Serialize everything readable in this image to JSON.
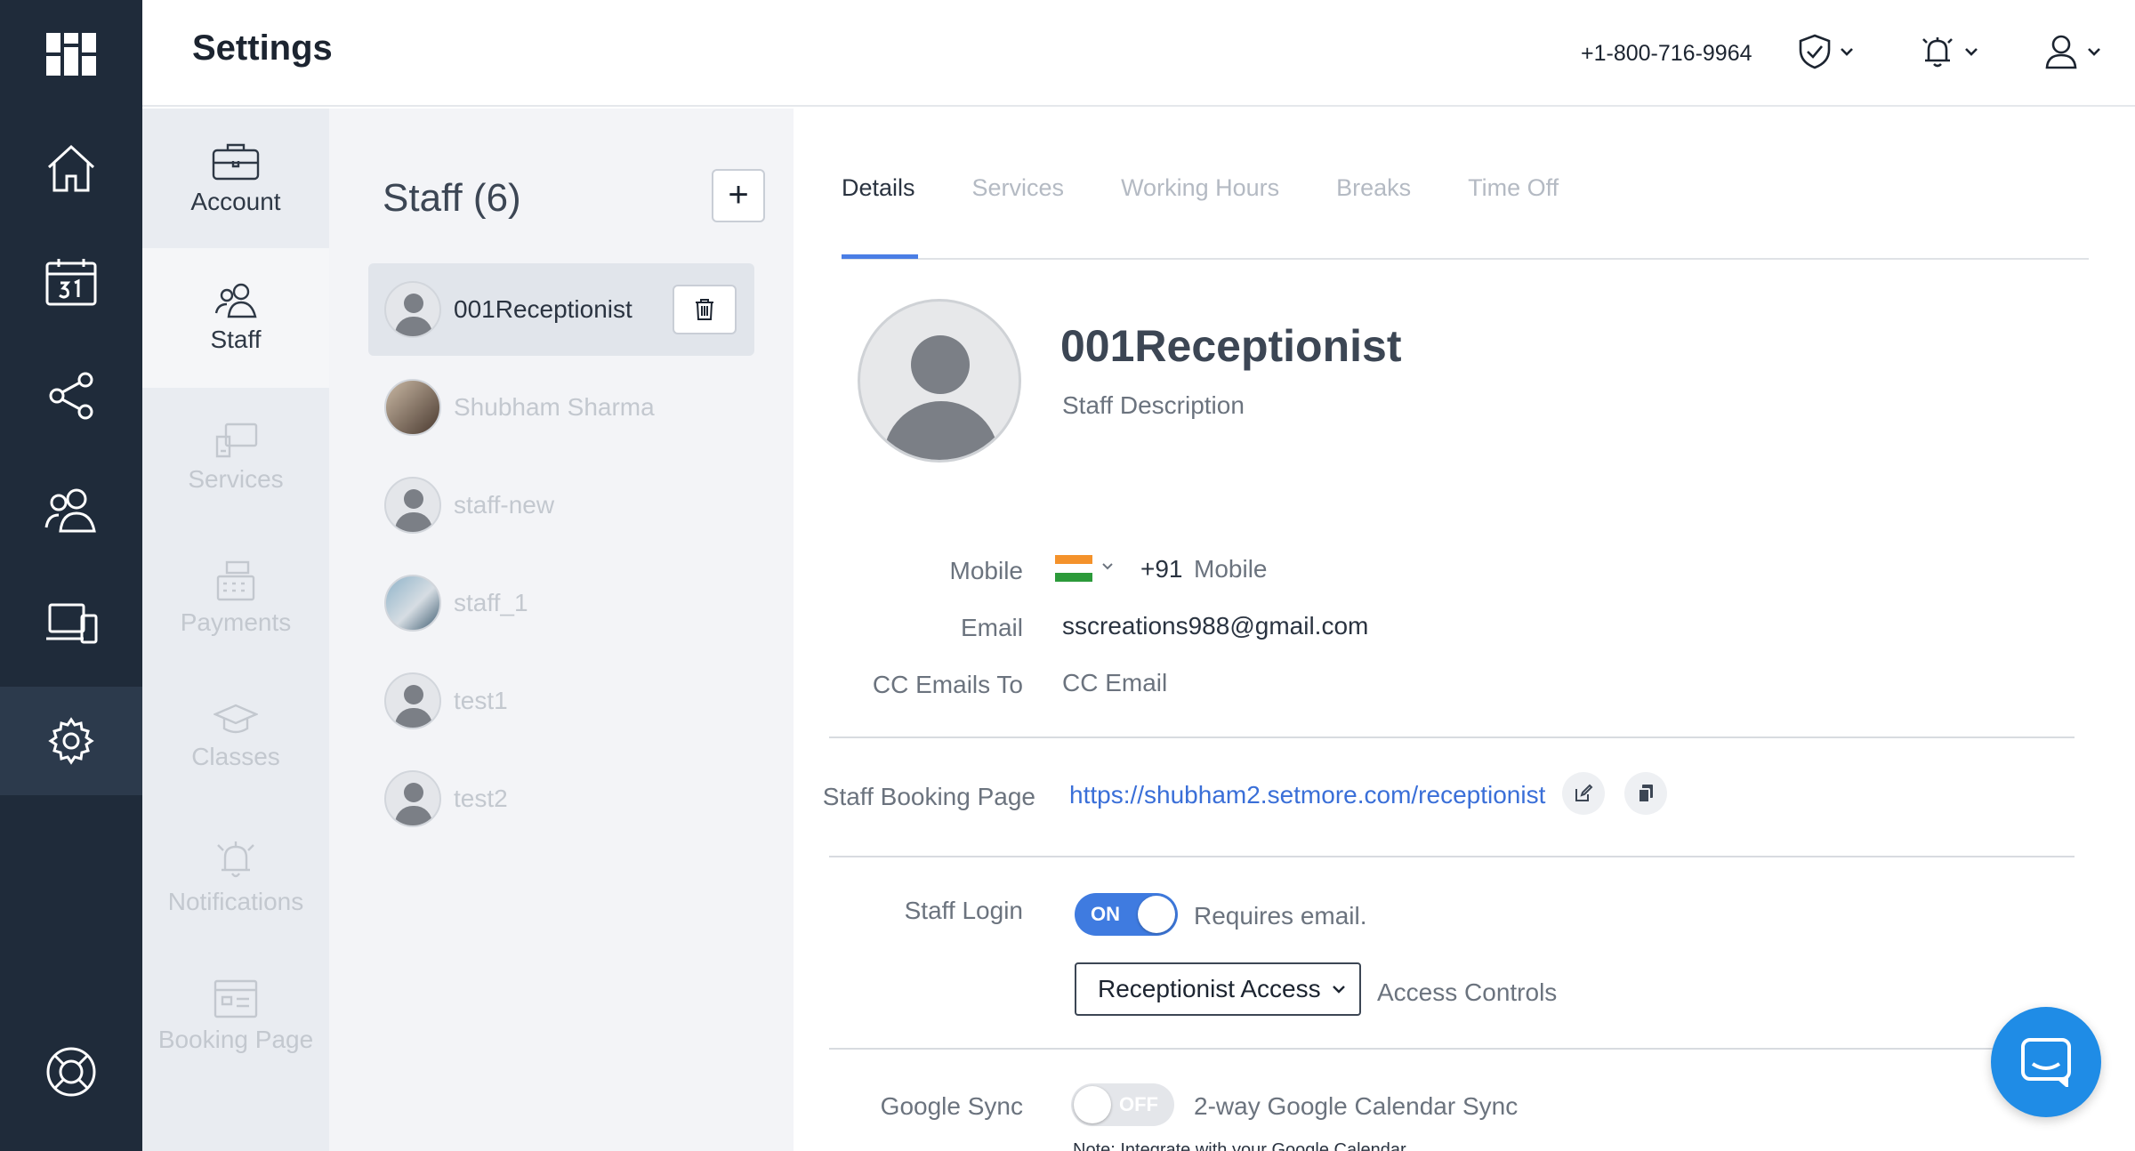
{
  "header": {
    "title": "Settings",
    "phone": "+1-800-716-9964"
  },
  "subnav": [
    {
      "label": "Account"
    },
    {
      "label": "Staff"
    },
    {
      "label": "Services"
    },
    {
      "label": "Payments"
    },
    {
      "label": "Classes"
    },
    {
      "label": "Notifications"
    },
    {
      "label": "Booking Page"
    }
  ],
  "staff_panel": {
    "heading": "Staff (6)",
    "add_label": "+",
    "members": [
      {
        "name": "001Receptionist"
      },
      {
        "name": "Shubham Sharma"
      },
      {
        "name": "staff-new"
      },
      {
        "name": "staff_1"
      },
      {
        "name": "test1"
      },
      {
        "name": "test2"
      }
    ]
  },
  "tabs": [
    "Details",
    "Services",
    "Working Hours",
    "Breaks",
    "Time Off"
  ],
  "details": {
    "name": "001Receptionist",
    "description": "Staff Description",
    "mobile_label": "Mobile",
    "country_code": "+91",
    "mobile_placeholder": "Mobile",
    "email_label": "Email",
    "email": "sscreations988@gmail.com",
    "cc_label": "CC Emails To",
    "cc_placeholder": "CC Email",
    "booking_label": "Staff Booking Page",
    "booking_url": "https://shubham2.setmore.com/receptionist",
    "login_label": "Staff Login",
    "login_toggle": "ON",
    "login_note": "Requires email.",
    "access_select": "Receptionist Access",
    "access_controls": "Access Controls",
    "sync_label": "Google Sync",
    "sync_toggle": "OFF",
    "sync_note": "2-way Google Calendar Sync",
    "integrate_note": "Note: Integrate with your Google Calendar"
  },
  "colors": {
    "nav_bg": "#1f2b3a",
    "accent": "#3f7be0",
    "link": "#3a6fd8",
    "chat": "#1f8ce6"
  }
}
